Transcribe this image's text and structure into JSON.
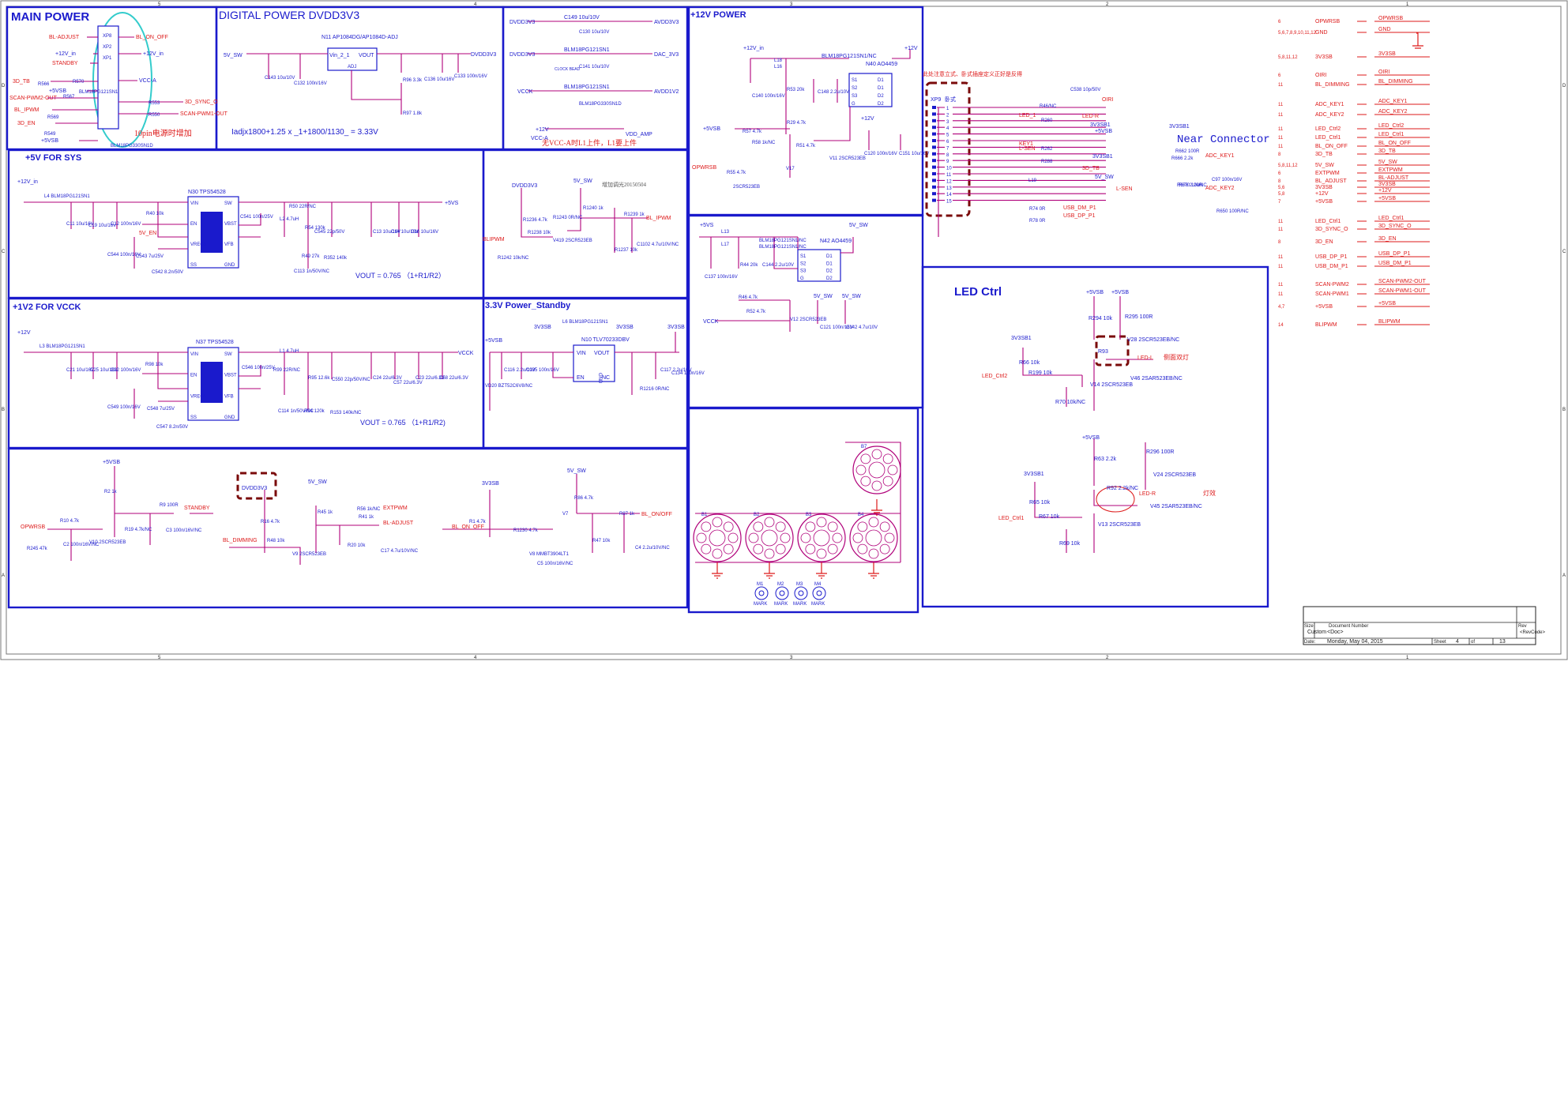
{
  "sections": {
    "main_power": "MAIN POWER",
    "digital_power": "DIGITAL POWER DVDD3V3",
    "p12v": "+12V POWER",
    "p5v": "+5V FOR SYS",
    "p1v2": "+1V2 FOR VCCK",
    "p33": "3.3V Power_Standby",
    "led": "LED Ctrl",
    "near": "Near Connector"
  },
  "main_power": {
    "nets_left": [
      "BL-ADJUST",
      "+12V_in",
      "STANDBY",
      "3D_TB",
      "+5VSB",
      "SCAN-PWM2-OUT",
      "BL_IPWM",
      "3D_EN",
      "+5VSB"
    ],
    "nets_right": [
      "BL_ON_OFF",
      "+12V_in",
      "VCC-A",
      "3D_SYNC_O",
      "SCAN-PWM1-OUT"
    ],
    "connectors": [
      "XP8",
      "XP2",
      "XP1"
    ],
    "parts": [
      "R566",
      "R567",
      "R569",
      "R549",
      "R553",
      "R550",
      "R570",
      "BLM18PG121SN1",
      "BLM18PG330SN1D"
    ],
    "note": "10pin电源时增加"
  },
  "digital_power": {
    "ic": "N11 AP1084DG/AP1084D-ADJ",
    "ic_pins": [
      "Vin_2_1",
      "VOUT",
      "ADJ"
    ],
    "in_net": "5V_SW",
    "out_net": "DVDD3V3",
    "caps": [
      "C143 10u/10V",
      "C132 100n/16V",
      "C136 10u/16V",
      "C133 100n/16V"
    ],
    "res": [
      "R96 3.3k",
      "R97 1.8k"
    ],
    "formula": "Iadjx1800+1.25 x _1+1800/1130_ = 3.33V"
  },
  "filters": {
    "nets": [
      "DVDD3V3",
      "AVDD3V3",
      "DVDD3V3",
      "DAC_3V3",
      "VCCK",
      "AVDD1V2",
      "+12V",
      "VCC-A",
      "VDD_AMP"
    ],
    "parts": [
      "L7",
      "L9",
      "L16",
      "L1",
      "C130 10u/10V",
      "C141 10u/10V",
      "C149 10u/10V",
      "BLM18PG121SN1",
      "BLM18PG121SN1",
      "BLM18PG330SN1D"
    ],
    "clock_bead": "CLOCK BEAD",
    "note": "无VCC-A时L1上件，L1要上件"
  },
  "pwm_block": {
    "nets": [
      "DVDD3V3",
      "5V_SW",
      "BL_IPWM",
      "BLIPWM"
    ],
    "parts": [
      "R1236 4.7k",
      "R1238 10k",
      "R1243 0R/NC",
      "R1240 1k",
      "R1239 1k",
      "R1237 10k",
      "R1242 10k/NC",
      "C1102 4.7u/10V/NC",
      "V419 2SCR523EB"
    ],
    "note": "增加调光20150504"
  },
  "p12v": {
    "nets": [
      "+12V_in",
      "+12V",
      "+5VSB",
      "OPWRSB",
      "+12V"
    ],
    "ic": "N40 AO4459",
    "ic_pins": [
      "S1",
      "S2",
      "S3",
      "G",
      "D1",
      "D1",
      "D2",
      "D2"
    ],
    "parts": [
      "L18",
      "L16",
      "BLM18PG121SN1/NC",
      "R53 20k",
      "C140 100n/16V",
      "C148 2.2u/10V",
      "R57 4.7k",
      "R55 4.7k",
      "R58 1k/NC",
      "R51 4.7k",
      "R29 4.7k",
      "V17",
      "V11 2SCR523EB",
      "C120 100n/16V",
      "C151 10u/16V",
      "2SCR523EB"
    ]
  },
  "p5v": {
    "nets": [
      "+12V_in",
      "+5VS",
      "5V_EN"
    ],
    "ic": "N30 TPS54528",
    "ic_pins": [
      "VIN",
      "EN",
      "VREG5",
      "SS",
      "SW",
      "VBST",
      "VFB",
      "GND",
      "EP"
    ],
    "parts": [
      "L4 BLM18PG121SN1",
      "C11 10u/16V",
      "C19 10u/16V",
      "C12 100n/16V",
      "R40 10k",
      "C544 100n/16V",
      "C543 7u/25V",
      "C542 8.2n/50V",
      "C541 100n/25V",
      "L2 4.7uH",
      "R50 22R/NC",
      "C113 1n/50V/NC",
      "R54 130k",
      "C545 22p/50V",
      "R49 27k",
      "R352 140k",
      "C13 10u/16V",
      "C14 10u/16V",
      "C16 10u/16V"
    ],
    "formula": "VOUT = 0.765 （1+R1/R2）"
  },
  "p1v2": {
    "nets": [
      "+12V",
      "VCCK"
    ],
    "ic": "N37 TPS54528",
    "ic_pins": [
      "VIN",
      "EN",
      "VREG5",
      "SS",
      "SW",
      "VBST",
      "VFB",
      "GND",
      "EP"
    ],
    "parts": [
      "L3 BLM18PG121SN1",
      "C21 10u/16V",
      "C25 10u/16V",
      "C22 100n/16V",
      "R98 10k",
      "C549 100n/16V",
      "C548 7u/25V",
      "C547 8.2n/50V",
      "C546 100n/25V",
      "L1 4.7uH",
      "R99 22R/NC",
      "C114 1n/50V/NC",
      "R95 12.6k",
      "C550 22p/50V/NC",
      "R94 120k",
      "R153 140k/NC",
      "C24 22u/6.3V",
      "C57 22u/6.3V",
      "C23 22u/6.3V",
      "C58 22u/6.3V"
    ],
    "formula": "VOUT = 0.765 （1+R1/R2)"
  },
  "p33": {
    "nets": [
      "+5VSB",
      "3V3SB",
      "3V3SB",
      "3V3SB"
    ],
    "ic": "N10 TLV70233DBV",
    "ic_pins": [
      "VIN",
      "EN",
      "GND",
      "VOUT",
      "NC"
    ],
    "parts": [
      "L6 BLM18PG121SN1",
      "VD20 BZT52C6V8/NC",
      "C116 2.2u/10V",
      "C135 100n/16V",
      "C117 2.2u/10V",
      "R1216 0R/NC",
      "C134 100n/16V"
    ]
  },
  "vcck_block": {
    "nets": [
      "+5VS",
      "5V_SW",
      "VCCK",
      "5V_SW",
      "5V_SW"
    ],
    "ic": "N42 AO4459",
    "ic_pins": [
      "S1",
      "S2",
      "S3",
      "G",
      "D1",
      "D1",
      "D2",
      "D2"
    ],
    "parts": [
      "L13",
      "L17",
      "BLM18PG121SN1/NC",
      "BLM18PG121SN1/NC",
      "C137 100n/16V",
      "R44 20k",
      "C144 2.2u/10V",
      "R46 4.7k",
      "R52 4.7k",
      "V12 2SCR523EB",
      "C121 100n/16V",
      "C142 4.7u/10V"
    ]
  },
  "bottom_left": {
    "nets": [
      "+5VSB",
      "OPWRSB",
      "STANDBY",
      "BL_DIMMING",
      "5V_SW",
      "EXTPWM",
      "BL-ADJUST",
      "3V3SB",
      "BL_ON_OFF",
      "5V_SW",
      "BL_ON/OFF"
    ],
    "highlight": "DVDD3V3",
    "parts": [
      "R2 1k",
      "R10 4.7k",
      "R245 47k",
      "C2 100n/16V/NC",
      "V10 2SCR523EB",
      "R19 4.7k/NC",
      "R9 100R",
      "C3 100n/16V/NC",
      "R16 4.7k",
      "R48 10k",
      "V9 2SCR523EB",
      "R45 1k",
      "R56 1k/NC",
      "R41 1k",
      "R20 10k",
      "C17 4.7u/10V/NC",
      "R1 4.7k",
      "R1230 4.7k",
      "V8 MMBT3904LT1",
      "C5 100n/16V/NC",
      "R86 4.7k",
      "V7",
      "R47 10k",
      "R87 1k",
      "C4 2.2u/10V/NC"
    ]
  },
  "mounting": {
    "holes": [
      "B7",
      "B1",
      "B2",
      "B3",
      "B4"
    ],
    "marks": [
      "M1",
      "M2",
      "M3",
      "M4"
    ],
    "mark_text": "MARK"
  },
  "connector": {
    "ref": "XP9",
    "note": "此处注意立式、卧式插座定义正好是反得",
    "variant": "卧式",
    "pins": [
      "1",
      "2",
      "3",
      "4",
      "5",
      "6",
      "7",
      "8",
      "9",
      "10",
      "11",
      "12",
      "13",
      "14",
      "15"
    ],
    "nets": [
      "3V3SB1",
      "OIRI",
      "LED_1",
      "LED-R",
      "+5VSB",
      "3V3SB1",
      "KEY1",
      "L-SEN",
      "3D_TB",
      "5V_SW",
      "L-SEN",
      "USB_DM_P1",
      "USB_DP_P1",
      "ADC_KEY1",
      "ADC_KEY2"
    ],
    "parts": [
      "C538 10p/50V",
      "R46/NC",
      "R260",
      "R262",
      "R288",
      "L19",
      "R662 100R",
      "R666 2.2k",
      "R676 2.2k/NC",
      "R670 100R",
      "C97 100n/16V",
      "R650 100R/NC",
      "R74 0R",
      "R78 0R"
    ]
  },
  "port_list": {
    "rows": [
      {
        "pin": "6",
        "name": "OPWRSB",
        "net": "OPWRSB"
      },
      {
        "pin": "5,6,7,8,9,10,11,12",
        "name": "GND",
        "net": "GND"
      },
      {
        "pin": "5,8,11,12",
        "name": "3V3SB",
        "net": "3V3SB"
      },
      {
        "pin": "6",
        "name": "OIRI",
        "net": "OIRI"
      },
      {
        "pin": "11",
        "name": "BL_DIMMING",
        "net": "BL_DIMMING"
      },
      {
        "pin": "11",
        "name": "ADC_KEY1",
        "net": "ADC_KEY1"
      },
      {
        "pin": "11",
        "name": "ADC_KEY2",
        "net": "ADC_KEY2"
      },
      {
        "pin": "11",
        "name": "LED_Ctrl2",
        "net": "LED_Ctrl2"
      },
      {
        "pin": "11",
        "name": "LED_Ctrl1",
        "net": "LED_Ctrl1"
      },
      {
        "pin": "11",
        "name": "BL_ON_OFF",
        "net": "BL_ON_OFF"
      },
      {
        "pin": "8",
        "name": "3D_TB",
        "net": "3D_TB"
      },
      {
        "pin": "5,8,11,12",
        "name": "5V_SW",
        "net": "5V_SW"
      },
      {
        "pin": "6",
        "name": "EXTPWM",
        "net": "EXTPWM"
      },
      {
        "pin": "8",
        "name": "BL_ADJUST",
        "net": "BL-ADJUST"
      },
      {
        "pin": "5,6",
        "name": "3V3SB",
        "net": "3V3SB"
      },
      {
        "pin": "5,8",
        "name": "+12V",
        "net": "+12V"
      },
      {
        "pin": "7",
        "name": "+5VSB",
        "net": "+5VSB"
      },
      {
        "pin": "11",
        "name": "LED_Ctrl1",
        "net": "LED_Ctrl1"
      },
      {
        "pin": "11",
        "name": "3D_SYNC_O",
        "net": "3D_SYNC_O"
      },
      {
        "pin": "8",
        "name": "3D_EN",
        "net": "3D_EN"
      },
      {
        "pin": "11",
        "name": "USB_DP_P1",
        "net": "USB_DP_P1"
      },
      {
        "pin": "11",
        "name": "USB_DM_P1",
        "net": "USB_DM_P1"
      },
      {
        "pin": "11",
        "name": "SCAN-PWM2",
        "net": "SCAN-PWM2-OUT"
      },
      {
        "pin": "11",
        "name": "SCAN-PWM1",
        "net": "SCAN-PWM1-OUT"
      },
      {
        "pin": "4,7",
        "name": "+5VSB",
        "net": "+5VSB"
      },
      {
        "pin": "14",
        "name": "BLIPWM",
        "net": "BLIPWM"
      }
    ]
  },
  "led_ctrl": {
    "nets": [
      "+5VSB",
      "+5VSB",
      "3V3SB1",
      "LED_Ctrl2",
      "LED-L",
      "+5VSB",
      "3V3SB1",
      "LED_Ctrl1",
      "LED-R"
    ],
    "parts": [
      "R294 10k",
      "R295 100R",
      "R93",
      "V28 2SCR523EB/NC",
      "V46 2SAR523EB/NC",
      "R66 10k",
      "R199 10k",
      "V14 2SCR523EB",
      "R70 10k/NC",
      "R63 2.2k",
      "R296 100R",
      "R92 2.2k/NC",
      "V24 2SCR523EB",
      "V45 2SAR523EB/NC",
      "R65 10k",
      "R67 10k",
      "R69 10k",
      "V13 2SCR523EB"
    ],
    "note1": "侧面双灯",
    "note2": "灯效"
  },
  "title_block": {
    "size_label": "Size",
    "size": "Custom",
    "docnum_label": "Document Number",
    "docnum": "<Doc>",
    "rev_label": "Rev",
    "rev": "<RevCode>",
    "date_label": "Date:",
    "date": "Monday, May 04, 2015",
    "sheet_label": "Sheet",
    "sheet": "4",
    "of_label": "of",
    "of": "13"
  },
  "border": {
    "cols": [
      "5",
      "4",
      "3",
      "2",
      "1"
    ],
    "rows": [
      "D",
      "C",
      "B",
      "A"
    ]
  },
  "colors": {
    "frame": "#1a1acc",
    "net": "#dd1a1a",
    "wire": "#b0007a",
    "highlight": "#7a0a0a",
    "cyan": "#33cccc"
  }
}
